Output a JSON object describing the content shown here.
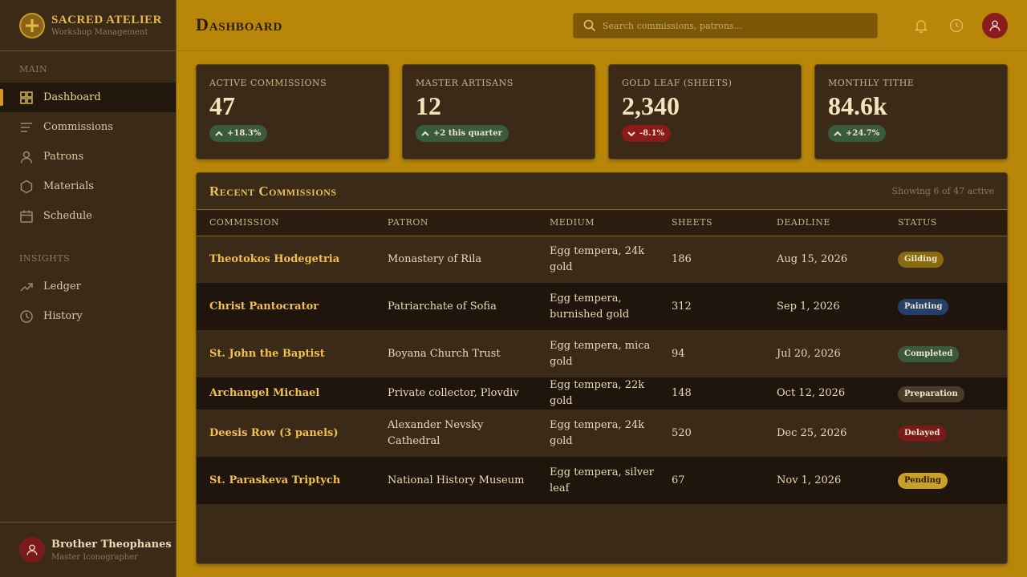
{
  "brand": {
    "title": "Sacred Atelier",
    "subtitle": "Workshop Management"
  },
  "sidebar": {
    "sections": [
      {
        "label": "Main",
        "items": [
          {
            "label": "Dashboard",
            "icon": "grid-icon",
            "active": true
          },
          {
            "label": "Commissions",
            "icon": "list-icon"
          },
          {
            "label": "Patrons",
            "icon": "user-icon"
          },
          {
            "label": "Materials",
            "icon": "hexagon-icon"
          },
          {
            "label": "Schedule",
            "icon": "calendar-icon"
          }
        ]
      },
      {
        "label": "Insights",
        "items": [
          {
            "label": "Ledger",
            "icon": "trend-icon"
          },
          {
            "label": "History",
            "icon": "clock-icon"
          }
        ]
      }
    ],
    "user": {
      "name": "Brother Theophanes",
      "role": "Master Iconographer"
    }
  },
  "header": {
    "title": "Dashboard",
    "search_placeholder": "Search commissions, patrons..."
  },
  "stats": [
    {
      "label": "Active Commissions",
      "value": "47",
      "delta": "+18.3%",
      "trend": "up"
    },
    {
      "label": "Master Artisans",
      "value": "12",
      "delta": "+2 this quarter",
      "trend": "up"
    },
    {
      "label": "Gold Leaf (Sheets)",
      "value": "2,340",
      "delta": "-8.1%",
      "trend": "down"
    },
    {
      "label": "Monthly Tithe",
      "value": "84.6k",
      "delta": "+24.7%",
      "trend": "up"
    }
  ],
  "table": {
    "title": "Recent Commissions",
    "meta": "Showing 6 of 47 active",
    "columns": [
      "Commission",
      "Patron",
      "Medium",
      "Sheets",
      "Deadline",
      "Status"
    ],
    "rows": [
      {
        "commission": "Theotokos Hodegetria",
        "patron": "Monastery of Rila",
        "medium": "Egg tempera, 24k gold",
        "sheets": "186",
        "deadline": "Aug 15, 2026",
        "status": "Gilding",
        "status_color": "#8a6a10"
      },
      {
        "commission": "Christ Pantocrator",
        "patron": "Patriarchate of Sofia",
        "medium": "Egg tempera, burnished gold",
        "sheets": "312",
        "deadline": "Sep 1, 2026",
        "status": "Painting",
        "status_color": "#24406a"
      },
      {
        "commission": "St. John the Baptist",
        "patron": "Boyana Church Trust",
        "medium": "Egg tempera, mica gold",
        "sheets": "94",
        "deadline": "Jul 20, 2026",
        "status": "Completed",
        "status_color": "#3a5a3e"
      },
      {
        "commission": "Archangel Michael",
        "patron": "Private collector, Plovdiv",
        "medium": "Egg tempera, 22k gold",
        "sheets": "148",
        "deadline": "Oct 12, 2026",
        "status": "Preparation",
        "status_color": "#4a3a28"
      },
      {
        "commission": "Deesis Row (3 panels)",
        "patron": "Alexander Nevsky Cathedral",
        "medium": "Egg tempera, 24k gold",
        "sheets": "520",
        "deadline": "Dec 25, 2026",
        "status": "Delayed",
        "status_color": "#7a1a1a"
      },
      {
        "commission": "St. Paraskeva Triptych",
        "patron": "National History Museum",
        "medium": "Egg tempera, silver leaf",
        "sheets": "67",
        "deadline": "Nov 1, 2026",
        "status": "Pending",
        "status_color": "#c9a028"
      }
    ]
  }
}
